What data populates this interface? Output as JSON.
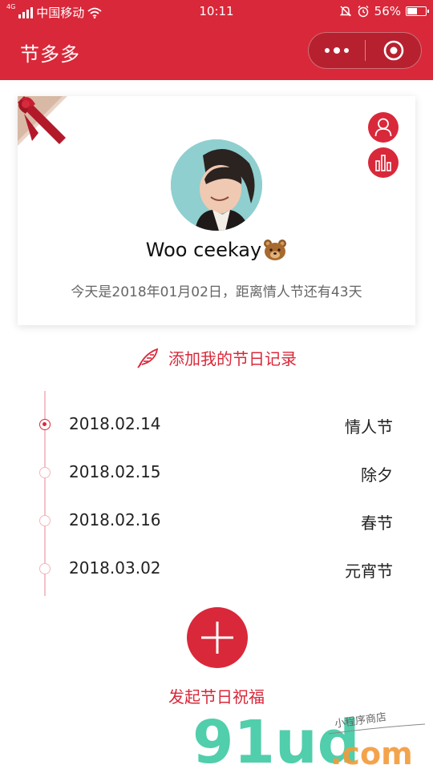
{
  "status_bar": {
    "network": "4G",
    "carrier": "中国移动",
    "time": "10:11",
    "battery": "56%",
    "battery_level": 0.56
  },
  "nav": {
    "title": "节多多"
  },
  "profile": {
    "username": "Woo ceekay",
    "countdown": "今天是2018年01月02日，距离情人节还有43天"
  },
  "add_record": {
    "label": "添加我的节日记录"
  },
  "timeline": [
    {
      "date": "2018.02.14",
      "name": "情人节",
      "active": true
    },
    {
      "date": "2018.02.15",
      "name": "除夕",
      "active": false
    },
    {
      "date": "2018.02.16",
      "name": "春节",
      "active": false
    },
    {
      "date": "2018.03.02",
      "name": "元宵节",
      "active": false
    }
  ],
  "launch": {
    "label": "发起节日祝福"
  },
  "watermark": {
    "logo_text": "91ud",
    "domain": ".com",
    "tagline": "小程序商店"
  },
  "colors": {
    "primary": "#d9283a",
    "timeline_line": "#f3c1c7",
    "watermark_teal": "#3fc9a3",
    "watermark_orange": "#f39a3a"
  }
}
